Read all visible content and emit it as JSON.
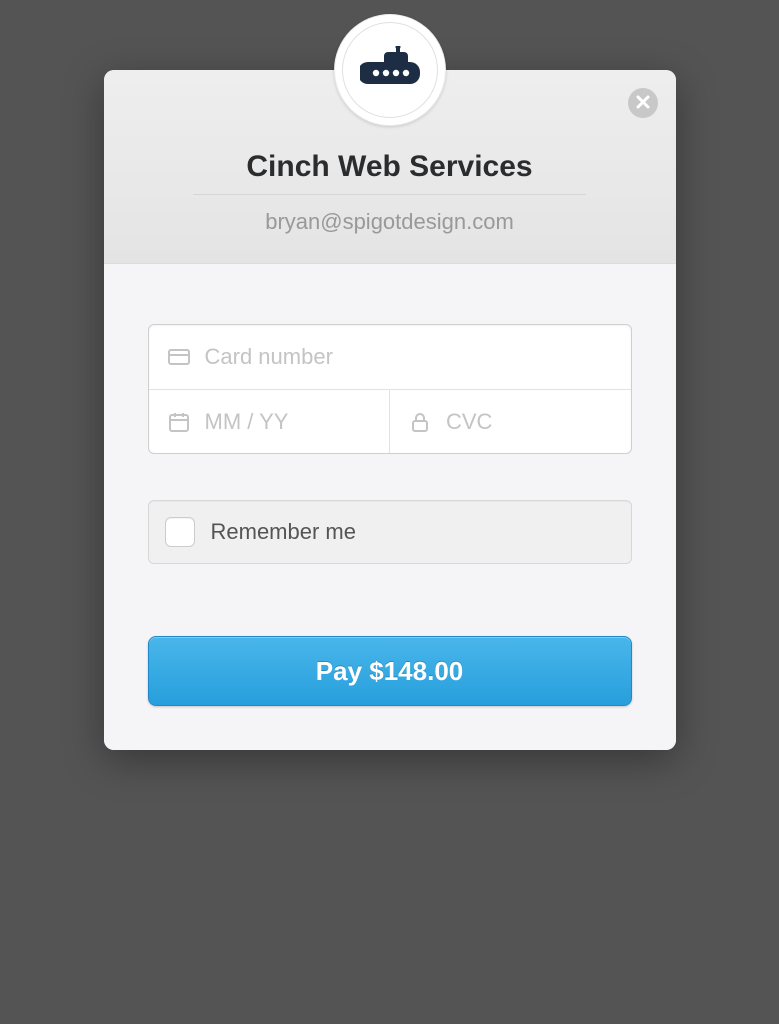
{
  "header": {
    "merchant_name": "Cinch Web Services",
    "email": "bryan@spigotdesign.com"
  },
  "form": {
    "card_placeholder": "Card number",
    "expiry_placeholder": "MM / YY",
    "cvc_placeholder": "CVC",
    "remember_label": "Remember me"
  },
  "actions": {
    "pay_label": "Pay $148.00"
  },
  "colors": {
    "brand_navy": "#1d2d44",
    "button_blue": "#31a4de"
  }
}
